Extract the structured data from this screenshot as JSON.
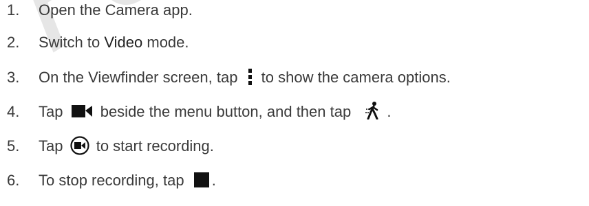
{
  "watermark": {
    "text": "For certifi"
  },
  "steps": [
    {
      "num": "1.",
      "text": "Open the Camera app."
    },
    {
      "num": "2.",
      "before": "Switch to ",
      "emphasis": "Video",
      "after": " mode."
    },
    {
      "num": "3.",
      "before": "On the Viewfinder screen, tap ",
      "icon": "vertical-menu-icon",
      "after": " to show the camera options."
    },
    {
      "num": "4.",
      "before": "Tap ",
      "icon": "video-camera-icon",
      "middle": " beside the menu button, and then tap ",
      "icon2": "walking-person-icon",
      "after": "."
    },
    {
      "num": "5.",
      "before": "Tap ",
      "icon": "record-button-icon",
      "after": " to start recording."
    },
    {
      "num": "6.",
      "before": "To stop recording, tap ",
      "icon": "stop-icon",
      "after": "."
    }
  ]
}
